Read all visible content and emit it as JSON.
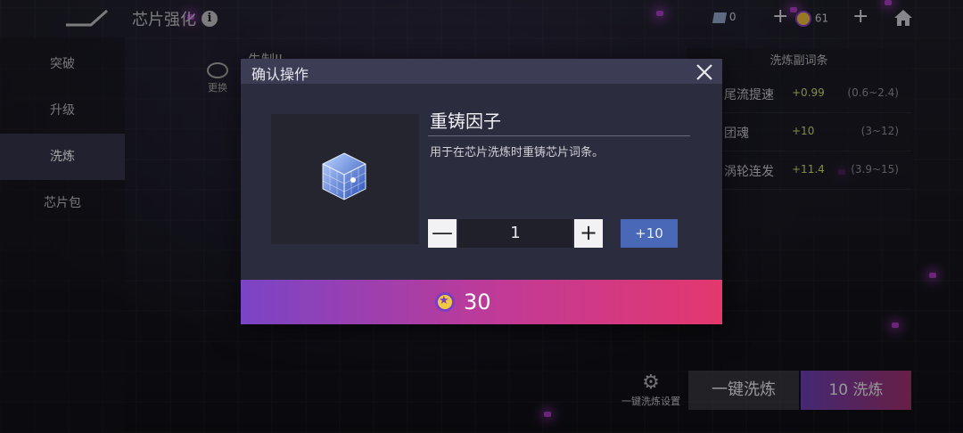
{
  "header": {
    "title": "芯片强化",
    "currency_a": "0",
    "currency_b": "61"
  },
  "sidebar": {
    "items": [
      {
        "label": "突破"
      },
      {
        "label": "升级"
      },
      {
        "label": "洗炼"
      },
      {
        "label": "芯片包"
      }
    ]
  },
  "background": {
    "change_label": "更换",
    "chip_title": "失制II",
    "sub_panel_title": "洗炼副词条",
    "sub_rows": [
      {
        "name": "尾流提速",
        "value": "+0.99",
        "range": "(0.6~2.4)"
      },
      {
        "name": "团魂",
        "value": "+10",
        "range": "(3~12)"
      },
      {
        "name": "涡轮连发",
        "value": "+11.4",
        "range": "(3.9~15)"
      }
    ],
    "settings_label": "一键洗炼设置",
    "one_key_label": "一键洗炼",
    "ten_label": "10 洗炼"
  },
  "dialog": {
    "title": "确认操作",
    "item_name": "重铸因子",
    "item_desc": "用于在芯片洗炼时重铸芯片词条。",
    "minus": "—",
    "plus": "+",
    "quantity": "1",
    "add_ten": "+10",
    "cost": "30"
  },
  "colors": {
    "accent_purple": "#7a44c6",
    "accent_pink": "#e4386e",
    "add_ten_blue": "#4a68b8"
  }
}
